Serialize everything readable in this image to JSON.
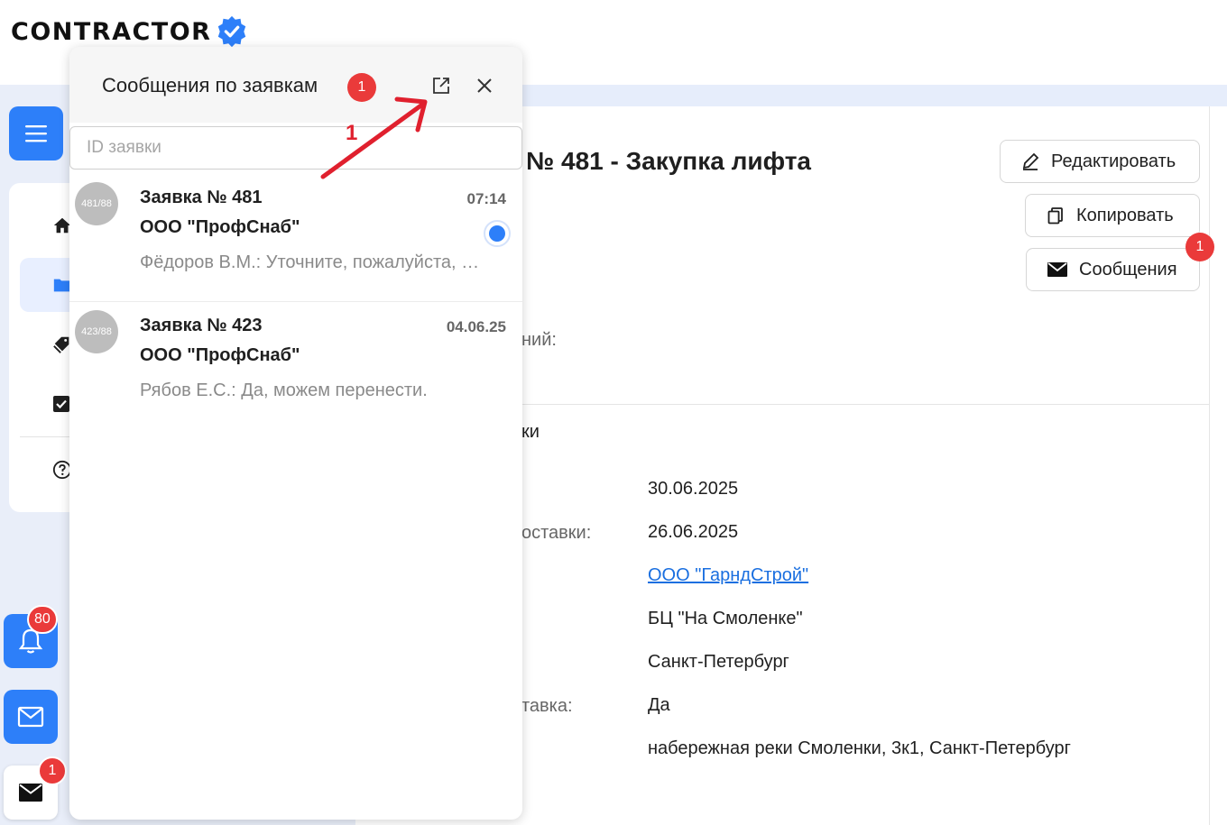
{
  "app": {
    "logo_text": "CONTRACTOR"
  },
  "sidebar": {
    "fabs": {
      "notifications_count": "80",
      "mail_count": "1"
    }
  },
  "order": {
    "title": "№ 481 - Закупка лифта",
    "actions": {
      "edit": "Редактировать",
      "copy": "Копировать",
      "messages": "Сообщения",
      "messages_badge": "1"
    },
    "partial_labels": {
      "comments": "ний:",
      "section": "ки",
      "delivery_date": "оставки:",
      "shipping": "тавка:"
    },
    "details": [
      "30.06.2025",
      "26.06.2025",
      "ООО \"ГарндСтрой\"",
      "БЦ \"На Смоленке\"",
      "Санкт-Петербург",
      "Да",
      "набережная реки Смоленки, 3к1, Санкт-Петербург"
    ]
  },
  "messages_panel": {
    "title": "Сообщения по заявкам",
    "badge": "1",
    "search_placeholder": "ID заявки",
    "items": [
      {
        "avatar": "481/88",
        "title": "Заявка № 481",
        "company": "ООО \"ПрофСнаб\"",
        "time": "07:14",
        "text": "Фёдоров В.М.: Уточните, пожалуйста, сроки поставки",
        "unread": true
      },
      {
        "avatar": "423/88",
        "title": "Заявка № 423",
        "company": "ООО \"ПрофСнаб\"",
        "time": "04.06.25",
        "text": "Рябов Е.С.: Да, можем перенести.",
        "unread": false
      }
    ]
  },
  "annotation": {
    "label": "1",
    "color": "#e0202e"
  },
  "colors": {
    "accent": "#2d7ff9",
    "badge": "#ea3a3a"
  }
}
